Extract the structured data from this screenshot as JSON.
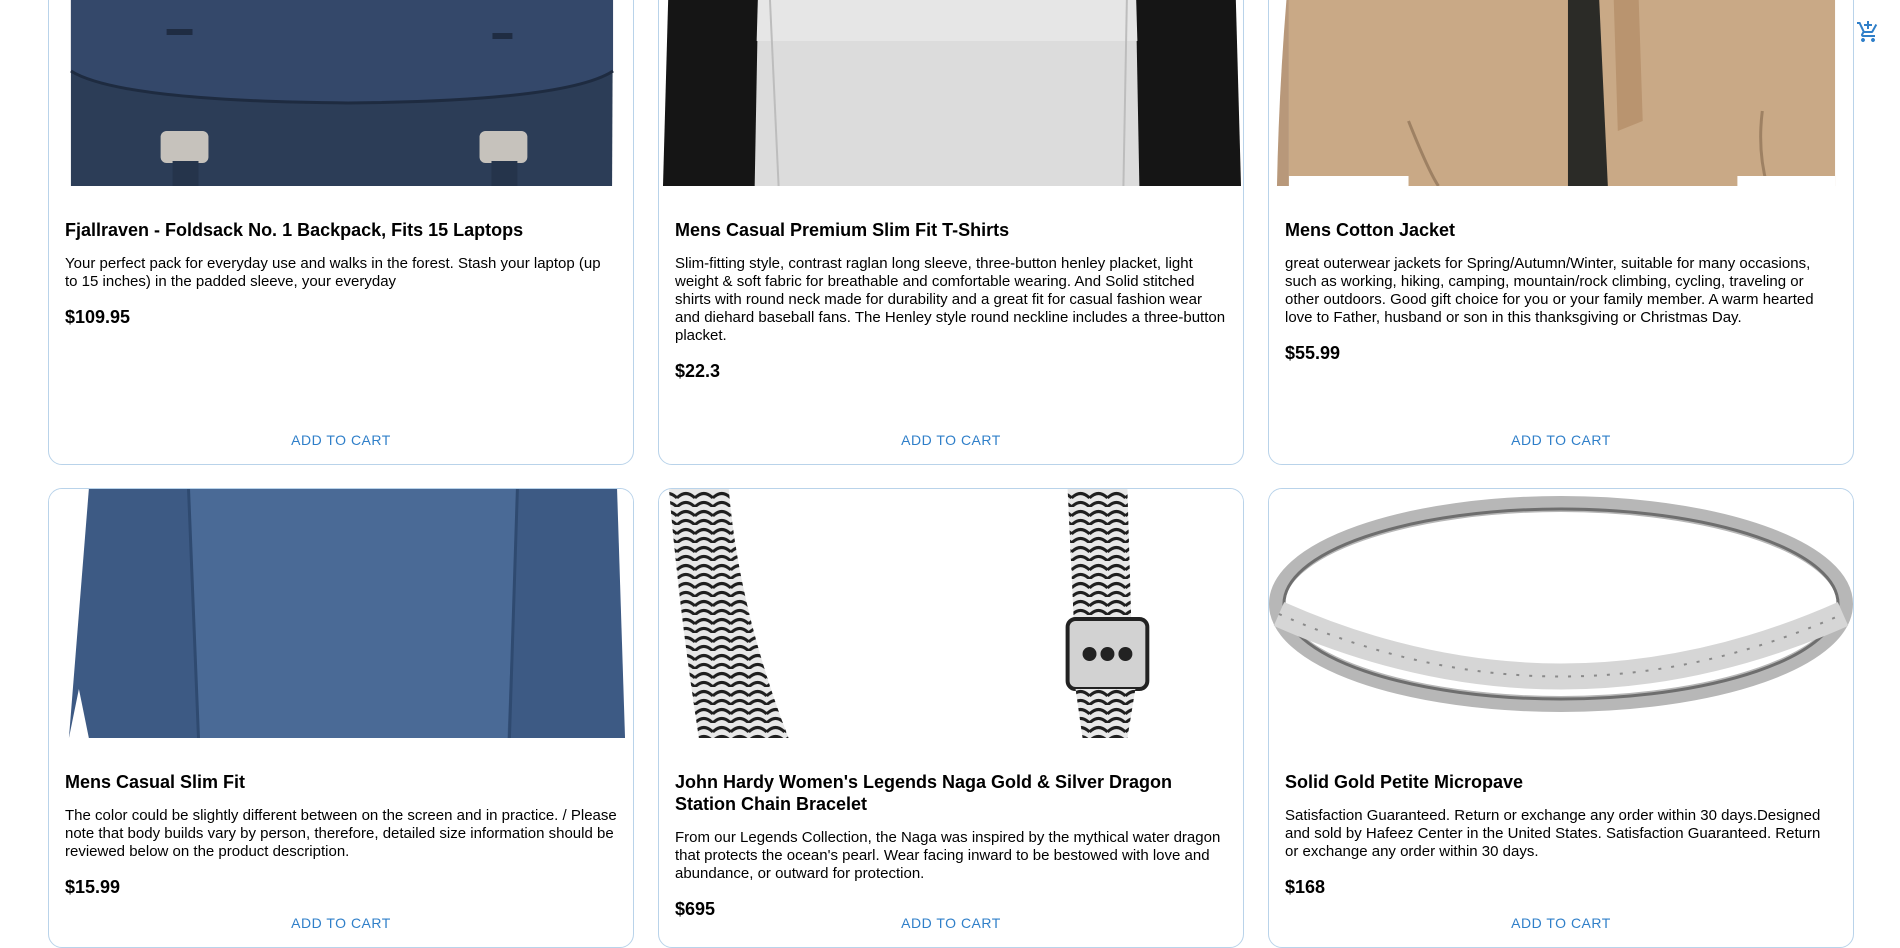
{
  "cart": {
    "icon": "add-shopping-cart-icon",
    "color": "#2f7fc9"
  },
  "products": [
    {
      "title": "Fjallraven - Foldsack No. 1 Backpack, Fits 15 Laptops",
      "description": "Your perfect pack for everyday use and walks in the forest. Stash your laptop (up to 15 inches) in the padded sleeve, your everyday",
      "price": "$109.95",
      "action": "ADD TO CART",
      "image": "navy backpack"
    },
    {
      "title": "Mens Casual Premium Slim Fit T-Shirts",
      "description": "Slim-fitting style, contrast raglan long sleeve, three-button henley placket, light weight & soft fabric for breathable and comfortable wearing. And Solid stitched shirts with round neck made for durability and a great fit for casual fashion wear and diehard baseball fans. The Henley style round neckline includes a three-button placket.",
      "price": "$22.3",
      "action": "ADD TO CART",
      "image": "grey raglan t-shirt"
    },
    {
      "title": "Mens Cotton Jacket",
      "description": "great outerwear jackets for Spring/Autumn/Winter, suitable for many occasions, such as working, hiking, camping, mountain/rock climbing, cycling, traveling or other outdoors. Good gift choice for you or your family member. A warm hearted love to Father, husband or son in this thanksgiving or Christmas Day.",
      "price": "$55.99",
      "action": "ADD TO CART",
      "image": "tan cotton jacket"
    },
    {
      "title": "Mens Casual Slim Fit",
      "description": "The color could be slightly different between on the screen and in practice. / Please note that body builds vary by person, therefore, detailed size information should be reviewed below on the product description.",
      "price": "$15.99",
      "action": "ADD TO CART",
      "image": "blue long sleeve shirt"
    },
    {
      "title": "John Hardy Women's Legends Naga Gold & Silver Dragon Station Chain Bracelet",
      "description": "From our Legends Collection, the Naga was inspired by the mythical water dragon that protects the ocean's pearl. Wear facing inward to be bestowed with love and abundance, or outward for protection.",
      "price": "$695",
      "action": "ADD TO CART",
      "image": "silver chain bracelet"
    },
    {
      "title": "Solid Gold Petite Micropave",
      "description": "Satisfaction Guaranteed. Return or exchange any order within 30 days.Designed and sold by Hafeez Center in the United States. Satisfaction Guaranteed. Return or exchange any order within 30 days.",
      "price": "$168",
      "action": "ADD TO CART",
      "image": "silver micropave ring"
    }
  ]
}
